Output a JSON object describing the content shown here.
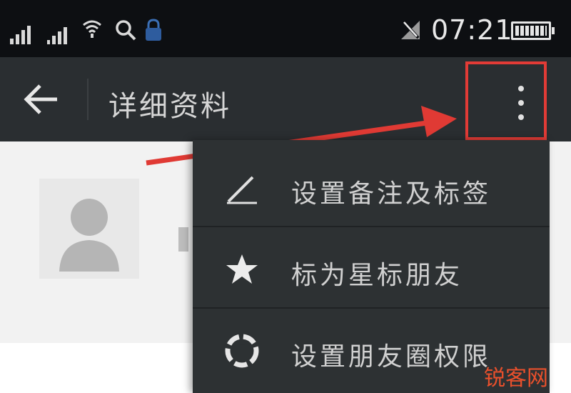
{
  "status_bar": {
    "time": "07:21",
    "icons": [
      "signal-icon",
      "signal-icon",
      "wifi-icon",
      "search-icon",
      "lock-icon",
      "no-service-icon",
      "battery-icon"
    ]
  },
  "action_bar": {
    "title": "详细资料",
    "back_icon": "arrow-left-icon",
    "more_icon": "more-vertical-icon"
  },
  "menu": {
    "items": [
      {
        "label": "设置备注及标签",
        "icon": "pencil-icon"
      },
      {
        "label": "标为星标朋友",
        "icon": "star-icon"
      },
      {
        "label": "设置朋友圈权限",
        "icon": "moments-icon"
      }
    ]
  },
  "watermark": "锐客网",
  "colors": {
    "status_bar": "#0d0f12",
    "action_bar": "#2a2e31",
    "menu": "#2d3133",
    "highlight": "#e23b36",
    "watermark": "#e9502c"
  }
}
